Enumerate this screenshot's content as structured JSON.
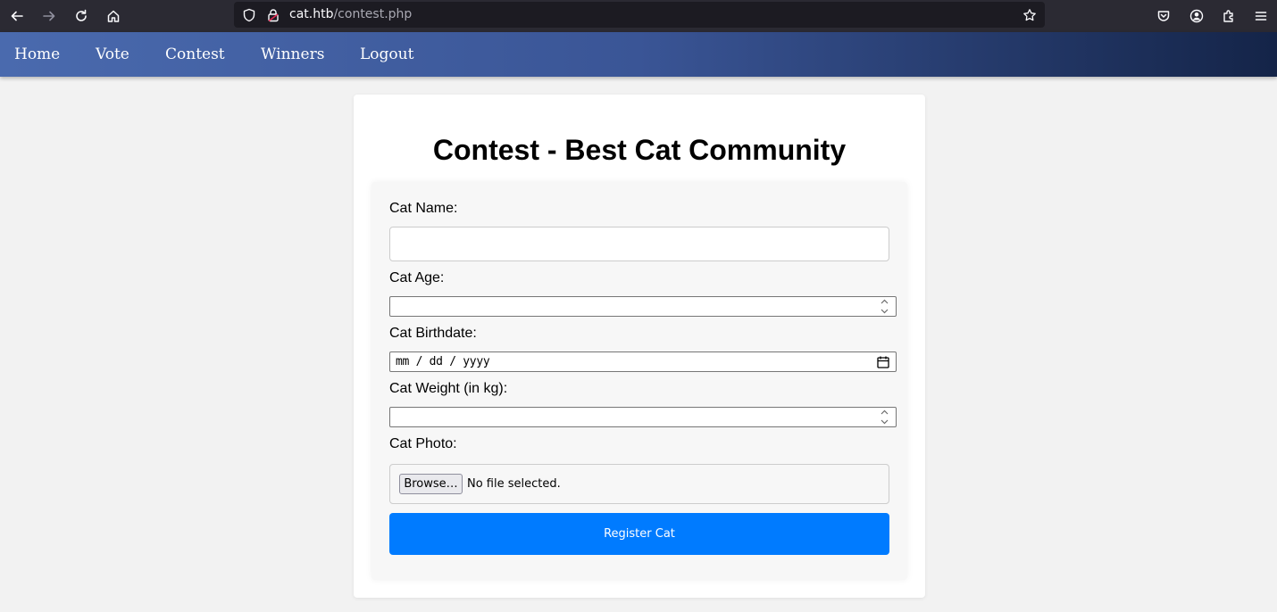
{
  "browser": {
    "url_host": "cat.htb",
    "url_path": "/contest.php",
    "icons": [
      "back-icon",
      "forward-icon",
      "reload-icon",
      "home-icon",
      "shield-icon",
      "lock-icon",
      "star-icon",
      "pocket-icon",
      "account-icon",
      "extensions-icon",
      "menu-icon"
    ]
  },
  "nav": {
    "items": [
      {
        "label": "Home"
      },
      {
        "label": "Vote"
      },
      {
        "label": "Contest"
      },
      {
        "label": "Winners"
      },
      {
        "label": "Logout"
      }
    ]
  },
  "page": {
    "title": "Contest - Best Cat Community"
  },
  "form": {
    "name_label": "Cat Name:",
    "name_value": "",
    "age_label": "Cat Age:",
    "birthdate_label": "Cat Birthdate:",
    "birthdate_placeholder": "mm / dd / yyyy",
    "weight_label": "Cat Weight (in kg):",
    "photo_label": "Cat Photo:",
    "browse_label": "Browse…",
    "file_status": "No file selected.",
    "submit_label": "Register Cat"
  },
  "colors": {
    "chrome": "#2b2a33",
    "urlbar": "#1c1b22",
    "nav_start": "#4a6aae",
    "nav_end": "#142448",
    "submit": "#007bff",
    "page_bg": "#f2f2f2"
  }
}
